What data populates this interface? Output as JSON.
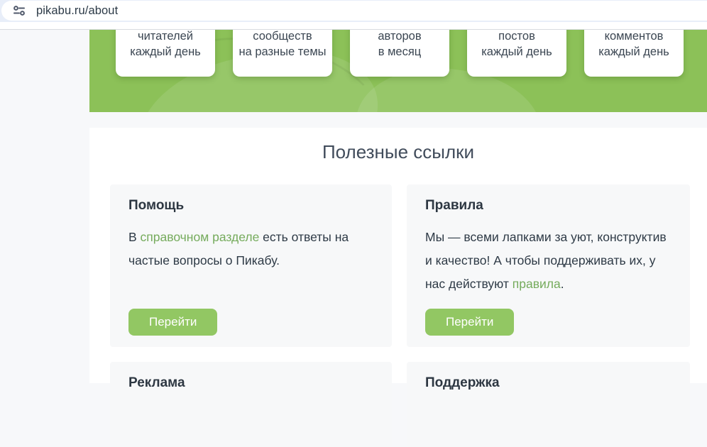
{
  "browser": {
    "url": "pikabu.ru/about"
  },
  "banner": {
    "stats": [
      {
        "line1": "читателей",
        "line2": "каждый день"
      },
      {
        "line1": "сообществ",
        "line2": "на разные темы"
      },
      {
        "line1": "авторов",
        "line2": "в месяц"
      },
      {
        "line1": "постов",
        "line2": "каждый день"
      },
      {
        "line1": "комментов",
        "line2": "каждый день"
      }
    ]
  },
  "links_section": {
    "title": "Полезные ссылки",
    "cards": [
      {
        "title": "Помощь",
        "text_before": "В ",
        "link_text": "справочном разделе",
        "text_after": " есть ответы на частые вопросы о Пикабу.",
        "button_label": "Перейти"
      },
      {
        "title": "Правила",
        "text_before": "Мы — всеми лапками за уют, конструктив и качество! А чтобы поддерживать их, у нас действуют ",
        "link_text": "правила",
        "text_after": ".",
        "button_label": "Перейти"
      },
      {
        "title": "Реклама"
      },
      {
        "title": "Поддержка"
      }
    ]
  },
  "colors": {
    "banner_green": "#8cc158",
    "button_green": "#92c763",
    "link_green": "#75ab5c",
    "browser_bar_blue": "#e8eef9"
  }
}
